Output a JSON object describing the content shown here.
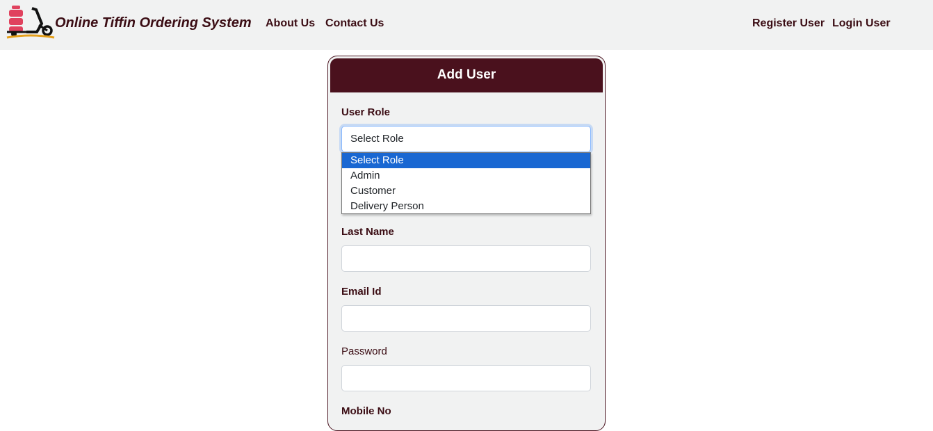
{
  "navbar": {
    "brand": "Online Tiffin Ordering System",
    "links": {
      "about": "About Us",
      "contact": "Contact Us",
      "register": "Register User",
      "login": "Login User"
    }
  },
  "form": {
    "title": "Add User",
    "user_role": {
      "label": "User Role",
      "value": "Select Role"
    },
    "role_options": [
      "Select Role",
      "Admin",
      "Customer",
      "Delivery Person"
    ],
    "last_name_label": "Last Name",
    "email_label": "Email Id",
    "password_label": "Password",
    "mobile_label": "Mobile No"
  },
  "colors": {
    "brand": "#3b0d14",
    "header": "#4a111d",
    "highlight": "#1967d2",
    "navbar_bg": "#f1f2f2"
  }
}
